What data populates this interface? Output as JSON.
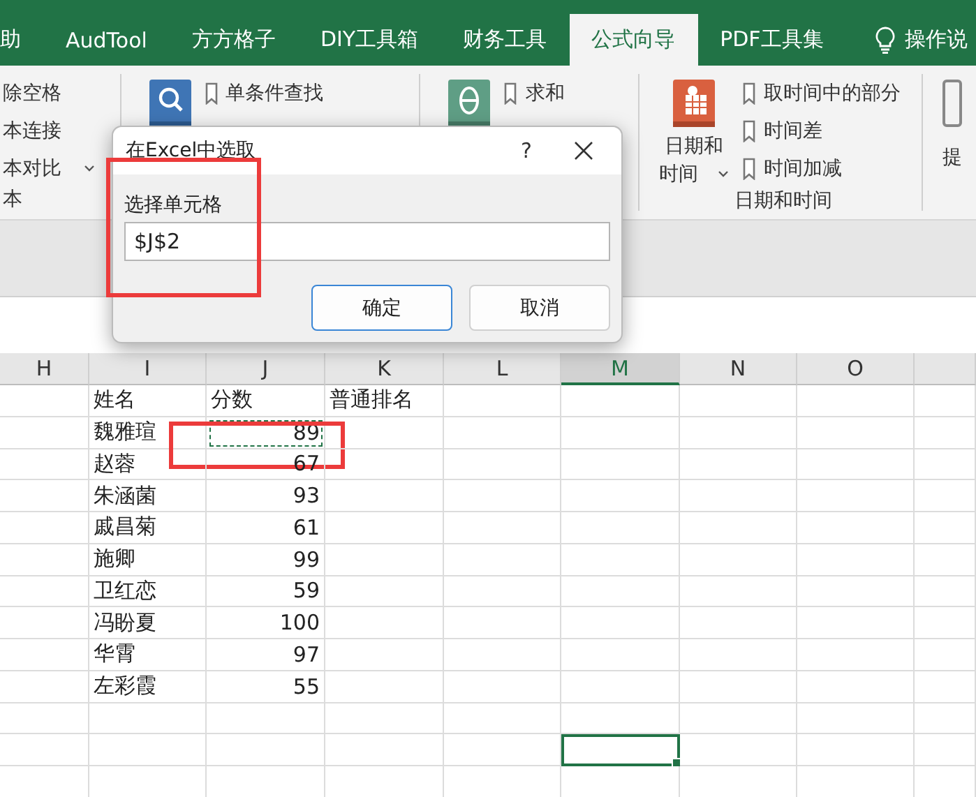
{
  "ribbon_tabs": [
    {
      "label": "助",
      "kind": "tab",
      "selected": false
    },
    {
      "label": "AudTool",
      "kind": "tab",
      "selected": false
    },
    {
      "label": "方方格子",
      "kind": "tab",
      "selected": false
    },
    {
      "label": "DIY工具箱",
      "kind": "tab",
      "selected": false
    },
    {
      "label": "财务工具",
      "kind": "tab",
      "selected": false
    },
    {
      "label": "公式向导",
      "kind": "tab",
      "selected": true
    },
    {
      "label": "PDF工具集",
      "kind": "tab",
      "selected": false
    },
    {
      "label": "操作说",
      "kind": "tell_me",
      "selected": false
    }
  ],
  "ribbon": {
    "groups": [
      {
        "kind": "list",
        "label": "本",
        "items": [
          {
            "label": "除空格",
            "has_menu": false
          },
          {
            "label": "本连接",
            "has_menu": false
          },
          {
            "label": "本对比",
            "has_menu": true
          }
        ]
      },
      {
        "kind": "icon_list",
        "items": [
          {
            "label": "单条件查找"
          }
        ]
      },
      {
        "kind": "icon_list",
        "items": [
          {
            "label": "求和"
          }
        ]
      },
      {
        "kind": "big_button",
        "label": "日期和时间",
        "button_lines": [
          "日期和",
          "时间"
        ],
        "items": [
          {
            "label": "取时间中的部分"
          },
          {
            "label": "时间差"
          },
          {
            "label": "时间加减"
          }
        ]
      },
      {
        "kind": "partial",
        "label": "提"
      }
    ]
  },
  "dialog": {
    "title": "在Excel中选取",
    "help": "?",
    "field": {
      "label": "选择单元格",
      "value": "$J$2",
      "highlighted": true
    },
    "buttons": [
      {
        "label": "确定",
        "focused": true
      },
      {
        "label": "取消",
        "focused": false
      }
    ]
  },
  "sheet": {
    "columns": [
      {
        "label": "H",
        "selected": false
      },
      {
        "label": "I",
        "selected": false
      },
      {
        "label": "J",
        "selected": false
      },
      {
        "label": "K",
        "selected": false
      },
      {
        "label": "L",
        "selected": false
      },
      {
        "label": "M",
        "selected": true
      },
      {
        "label": "N",
        "selected": false
      },
      {
        "label": "O",
        "selected": false
      }
    ],
    "header_row": [
      "姓名",
      "分数",
      "普通排名"
    ],
    "rows": [
      {
        "name": "魏雅瑄",
        "score": "89",
        "copy_marquee": true,
        "highlighted": true
      },
      {
        "name": "赵蓉",
        "score": "67",
        "copy_marquee": false,
        "highlighted": false
      },
      {
        "name": "朱涵菌",
        "score": "93",
        "copy_marquee": false,
        "highlighted": false
      },
      {
        "name": "戚昌菊",
        "score": "61",
        "copy_marquee": false,
        "highlighted": false
      },
      {
        "name": "施卿",
        "score": "99",
        "copy_marquee": false,
        "highlighted": false
      },
      {
        "name": "卫红恋",
        "score": "59",
        "copy_marquee": false,
        "highlighted": false
      },
      {
        "name": "冯盼夏",
        "score": "100",
        "copy_marquee": false,
        "highlighted": false
      },
      {
        "name": "华霄",
        "score": "97",
        "copy_marquee": false,
        "highlighted": false
      },
      {
        "name": "左彩霞",
        "score": "55",
        "copy_marquee": false,
        "highlighted": false
      }
    ]
  }
}
